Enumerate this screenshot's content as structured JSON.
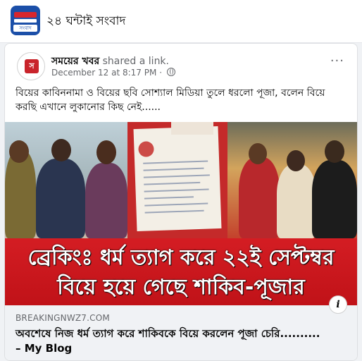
{
  "group": {
    "name": "২৪ ঘন্টাই সংবাদ",
    "logo_label": "সংবাদ"
  },
  "post": {
    "author": "সময়ের খবর",
    "action": "shared a link.",
    "date": "December 12 at 8:17 PM",
    "separator": "·",
    "text": "বিয়ের কাবিননামা ও বিয়ের ছবি সোশ্যাল মিডিয়া তুলে ধরলো পূজা, বলেন বিয়ে করছি এখানে লুকানোর কিছ নেই......",
    "more_glyph": "···",
    "avatar_mark": "স"
  },
  "image": {
    "banner_line1": "ব্রেকিংঃ ধর্ম ত্যাগ করে ২২ই সেপ্টম্বর",
    "banner_line2": "বিয়ে হয়ে গেছে শাকিব-পূজার"
  },
  "link": {
    "domain": "BREAKINGNWZ7.COM",
    "title": "অবশেষে নিজ ধর্ম ত্যাগ করে শাকিবকে বিয়ে করলেন পূজা চেরি.......... – My Blog",
    "info_glyph": "i"
  },
  "colors": {
    "banner_red": "#c8181e",
    "background": "#f0f2f5",
    "secondary_text": "#65676b"
  }
}
